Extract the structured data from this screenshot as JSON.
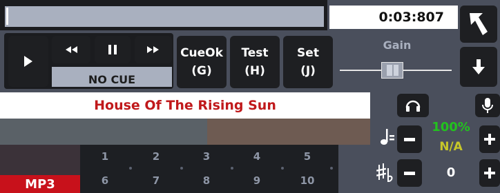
{
  "colors": {
    "background": "#4a4f5c",
    "button": "#1e1f22",
    "track_title": "#c0191b",
    "percent": "#22c21e",
    "key_na": "#c7c729",
    "format_badge": "#c8111b"
  },
  "transport": {
    "time": "0:03:807",
    "cue_status": "NO CUE"
  },
  "buttons": {
    "cue_ok": "CueOk",
    "cue_ok_key": "(G)",
    "test": "Test",
    "test_key": "(H)",
    "set": "Set",
    "set_key": "(J)"
  },
  "gain": {
    "label": "Gain",
    "level": 0.46
  },
  "track": {
    "title": "House Of The Rising Sun",
    "format": "MP3"
  },
  "tempo": {
    "percent": "100%",
    "key": "N/A",
    "pitch": "0"
  },
  "hotcues": {
    "row1": [
      "1",
      "2",
      "3",
      "4",
      "5"
    ],
    "row2": [
      "6",
      "7",
      "8",
      "9",
      "10"
    ]
  },
  "icons": [
    "play-icon",
    "rewind-icon",
    "pause-icon",
    "fast-forward-icon",
    "eject-arrow-icon",
    "down-arrow-icon",
    "headphones-icon",
    "microphone-icon",
    "tempo-note-icon",
    "key-sharp-flat-icon",
    "minus-icon",
    "plus-icon"
  ]
}
